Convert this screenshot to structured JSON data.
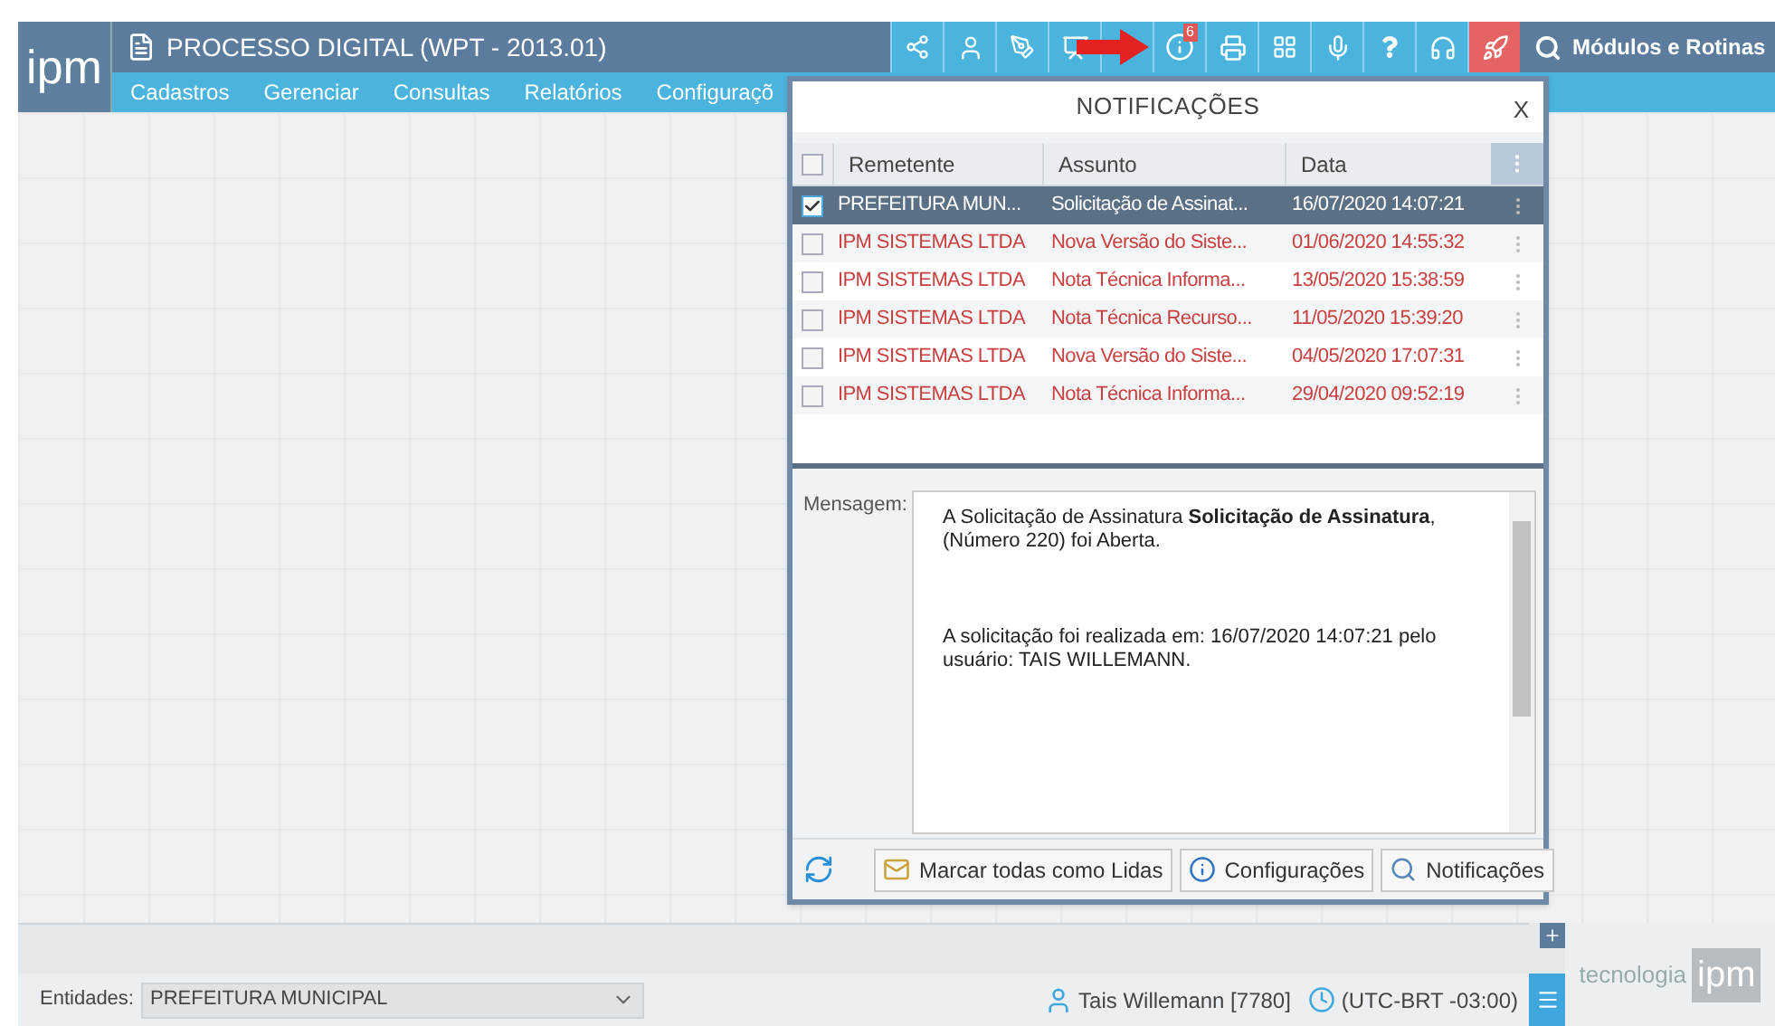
{
  "app": {
    "logo": "ipm",
    "title": "PROCESSO DIGITAL (WPT - 2013.01)",
    "menu": [
      "Cadastros",
      "Gerenciar",
      "Consultas",
      "Relatórios",
      "Configuraçõ"
    ],
    "notification_badge": "6",
    "search_label": "Módulos e Rotinas"
  },
  "notifications": {
    "title": "NOTIFICAÇÕES",
    "close": "X",
    "select_all_checked": false,
    "columns": [
      "Remetente",
      "Assunto",
      "Data"
    ],
    "rows": [
      {
        "sender": "PREFEITURA MUN...",
        "subject": "Solicitação de Assinat...",
        "date": "16/07/2020 14:07:21",
        "checked": true,
        "selected": true,
        "unread": false
      },
      {
        "sender": "IPM SISTEMAS LTDA",
        "subject": "Nova Versão do Siste...",
        "date": "01/06/2020 14:55:32",
        "checked": false,
        "selected": false,
        "unread": true
      },
      {
        "sender": "IPM SISTEMAS LTDA",
        "subject": "Nota Técnica Informa...",
        "date": "13/05/2020 15:38:59",
        "checked": false,
        "selected": false,
        "unread": true
      },
      {
        "sender": "IPM SISTEMAS LTDA",
        "subject": "Nota Técnica Recurso...",
        "date": "11/05/2020 15:39:20",
        "checked": false,
        "selected": false,
        "unread": true
      },
      {
        "sender": "IPM SISTEMAS LTDA",
        "subject": "Nova Versão do Siste...",
        "date": "04/05/2020 17:07:31",
        "checked": false,
        "selected": false,
        "unread": true
      },
      {
        "sender": "IPM SISTEMAS LTDA",
        "subject": "Nota Técnica Informa...",
        "date": "29/04/2020 09:52:19",
        "checked": false,
        "selected": false,
        "unread": true
      }
    ],
    "message_label": "Mensagem:",
    "message": [
      "A Solicitação de Assinatura **Solicitação de Assinatura**, (Número 220) foi Aberta.",
      "A solicitação foi realizada em: 16/07/2020 14:07:21 pelo usuário: TAIS WILLEMANN."
    ],
    "buttons": [
      {
        "kind": "mark-read",
        "label": "Marcar todas como Lidas"
      },
      {
        "kind": "settings",
        "label": "Configurações"
      },
      {
        "kind": "search",
        "label": "Notificações"
      }
    ]
  },
  "footer": {
    "entity_label": "Entidades:",
    "entity_value": "PREFEITURA MUNICIPAL",
    "user": "Tais Willemann [7780]",
    "timezone": "(UTC-BRT -03:00)",
    "brand_text": "tecnologia",
    "brand_logo": "ipm"
  }
}
